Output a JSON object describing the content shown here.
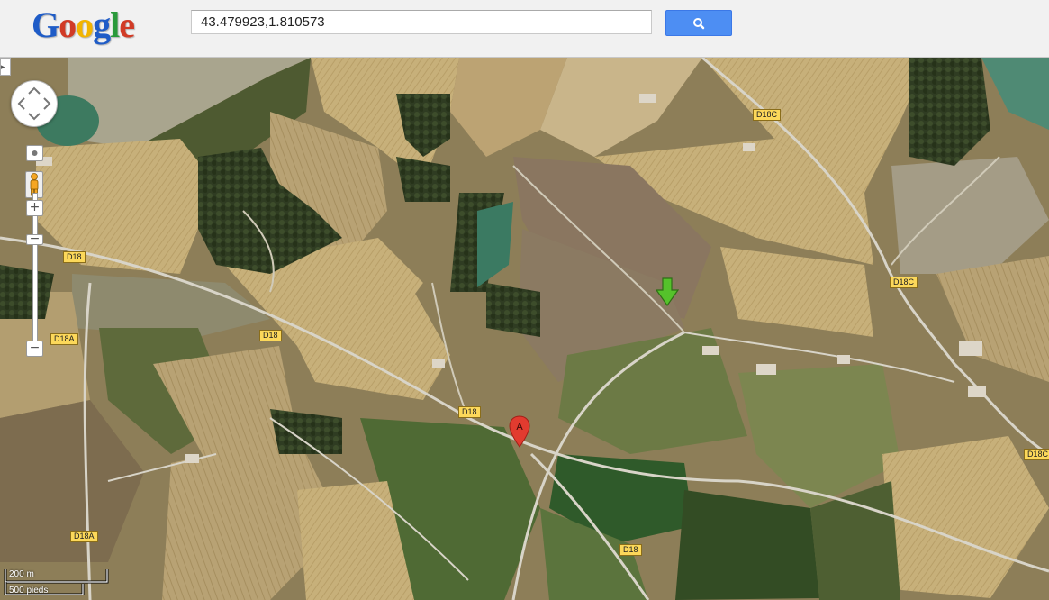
{
  "header": {
    "logo_letters": [
      {
        "char": "G",
        "color": "#1f5cc7"
      },
      {
        "char": "o",
        "color": "#d13b26"
      },
      {
        "char": "o",
        "color": "#f2b400"
      },
      {
        "char": "g",
        "color": "#1f5cc7"
      },
      {
        "char": "l",
        "color": "#2a9a3b"
      },
      {
        "char": "e",
        "color": "#d13b26"
      }
    ],
    "search_value": "43.479923,1.810573",
    "search_button_icon": "magnifier-icon",
    "accent_color": "#4d8ef3"
  },
  "map": {
    "view": "satellite",
    "road_labels": [
      "D18C",
      "D18C",
      "D18C",
      "D18",
      "D18",
      "D18",
      "D18",
      "D18A",
      "D18A"
    ],
    "markers": [
      {
        "name": "search-result-marker",
        "label": "A",
        "color": "#e23b2f"
      },
      {
        "name": "green-arrow-marker",
        "label": "",
        "color": "#55c22b"
      }
    ]
  },
  "controls": {
    "pan_icon": "pan-arrows-icon",
    "zoom_in": "+",
    "zoom_out": "−",
    "pegman_icon": "pegman-icon"
  },
  "scale": {
    "metric": "200 m",
    "imperial": "500 pieds"
  }
}
